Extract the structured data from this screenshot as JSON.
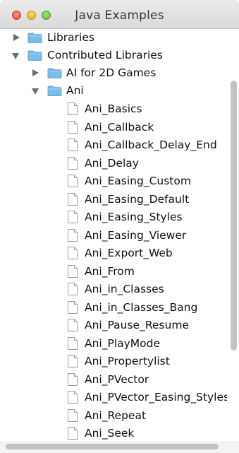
{
  "window": {
    "title": "Java Examples"
  },
  "tree": {
    "libraries": {
      "label": "Libraries",
      "expanded": false
    },
    "contributed": {
      "label": "Contributed Libraries",
      "expanded": true
    },
    "ai2d": {
      "label": "AI for 2D Games",
      "expanded": false
    },
    "ani": {
      "label": "Ani",
      "expanded": true
    },
    "files": [
      "Ani_Basics",
      "Ani_Callback",
      "Ani_Callback_Delay_End",
      "Ani_Delay",
      "Ani_Easing_Custom",
      "Ani_Easing_Default",
      "Ani_Easing_Styles",
      "Ani_Easing_Viewer",
      "Ani_Export_Web",
      "Ani_From",
      "Ani_in_Classes",
      "Ani_in_Classes_Bang",
      "Ani_Pause_Resume",
      "Ani_PlayMode",
      "Ani_Propertylist",
      "Ani_PVector",
      "Ani_PVector_Easing_Styles",
      "Ani_Repeat",
      "Ani_Seek"
    ]
  },
  "icons": {
    "folder": "folder-icon",
    "file": "document-icon",
    "collapsed": "disclosure-right-icon",
    "expanded": "disclosure-down-icon"
  },
  "colors": {
    "folder_blue": "#6fb6e8",
    "title_bar": "#e3e3e3",
    "close": "#e2463c",
    "minimize": "#e4a82a",
    "zoom": "#5db53d"
  }
}
